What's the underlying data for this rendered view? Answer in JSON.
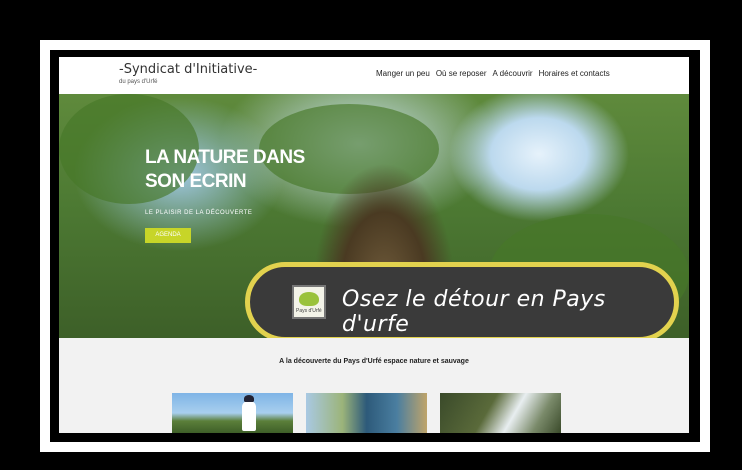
{
  "header": {
    "site_title": "-Syndicat d'Initiative-",
    "site_subtitle": "du pays d'Urfé"
  },
  "nav": {
    "items": [
      {
        "label": "Manger un peu"
      },
      {
        "label": "Où se reposer"
      },
      {
        "label": "A découvrir"
      },
      {
        "label": "Horaires et contacts"
      }
    ]
  },
  "hero": {
    "title_line1": "LA NATURE DANS",
    "title_line2": "SON ECRIN",
    "subtitle": "LE PLAISIR DE LA DÉCOUVERTE",
    "button_label": "AGENDA"
  },
  "banner": {
    "slogan": "Osez le détour en Pays d'urfe",
    "logo_text": "Pays d'Urfé"
  },
  "content": {
    "intro": "A la découverte du Pays d'Urfé espace nature et sauvage"
  },
  "colors": {
    "accent_button": "#c7d528",
    "banner_border": "#e2d24e",
    "banner_fill": "#3a3a3a"
  }
}
